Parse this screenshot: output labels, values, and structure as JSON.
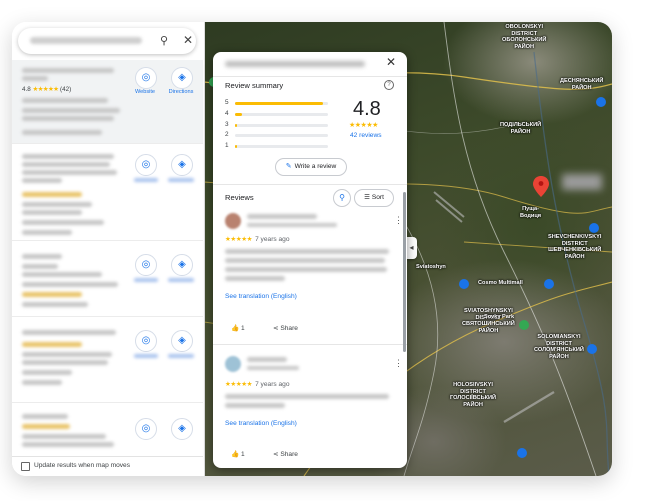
{
  "left_panel": {
    "search": {
      "icon": "search-icon",
      "close_icon": "close-icon"
    },
    "selected_result": {
      "rating": "4.8",
      "stars": "★★★★★",
      "count": "(42)",
      "website_label": "Website",
      "directions_label": "Directions"
    },
    "update_checkbox_label": "Update results when map moves"
  },
  "map": {
    "labels": [
      {
        "id": "obolonskyi",
        "text": "OBOLONSKYI\nDISTRICT\nОБОЛОНСЬКИЙ\nРАЙОН"
      },
      {
        "id": "desenskyi",
        "text": "ДЕСНЯНСЬКИЙ\nРАЙОН"
      },
      {
        "id": "podilskyi",
        "text": "ПОДІЛЬСЬКИЙ\nРАЙОН"
      },
      {
        "id": "sviatoshynskyi",
        "text": "SVIATOSHYNSKYI\nDISTRICT\nСВЯТОШИНСЬКИЙ\nРАЙОН"
      },
      {
        "id": "shevchenkivskyi",
        "text": "SHEVCHENKIVSKYI\nDISTRICT\nШЕВЧЕНКІВСЬКИЙ\nРАЙОН"
      },
      {
        "id": "solomianskyi",
        "text": "SOLOMIANSKYI\nDISTRICT\nСОЛОМ'ЯНСЬКИЙ\nРАЙОН"
      },
      {
        "id": "holosiivskyi",
        "text": "HOLOSIIVSKYI\nDISTRICT\nГОЛОСІЇВСЬКИЙ\nРАЙОН"
      },
      {
        "id": "sviatoshyn",
        "text": "Sviatoshyn"
      },
      {
        "id": "cosmo",
        "text": "Cosmo Multimall"
      },
      {
        "id": "sovky",
        "text": "Sovky Park"
      },
      {
        "id": "pushcha",
        "text": "Пуща-\nВодиця"
      }
    ],
    "colors": {
      "road": "#e2c14b",
      "pin": "#ea4335",
      "poi": "#1a73e8"
    }
  },
  "review_panel": {
    "close_icon": "close-icon",
    "summary_title": "Review summary",
    "help_icon": "?",
    "bars": [
      {
        "stars": "5",
        "fraction": 0.95
      },
      {
        "stars": "4",
        "fraction": 0.08
      },
      {
        "stars": "3",
        "fraction": 0.02
      },
      {
        "stars": "2",
        "fraction": 0.0
      },
      {
        "stars": "1",
        "fraction": 0.02
      }
    ],
    "average": "4.8",
    "stars": "★★★★★",
    "review_count": "42 reviews",
    "write_review_label": "Write a review",
    "reviews_title": "Reviews",
    "sort_label": "Sort",
    "reviews": [
      {
        "stars": "★★★★★",
        "time": "7 years ago",
        "translate": "See translation (English)",
        "like_count": "1",
        "share": "Share"
      },
      {
        "stars": "★★★★★",
        "time": "7 years ago",
        "translate": "See translation (English)",
        "like_count": "1",
        "share": "Share"
      }
    ]
  }
}
